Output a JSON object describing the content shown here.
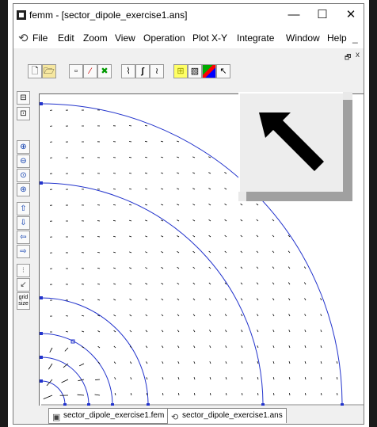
{
  "window": {
    "title": "femm - [sector_dipole_exercise1.ans]",
    "minimize_glyph": "—",
    "maximize_glyph": "☐",
    "close_glyph": "✕"
  },
  "menu": {
    "items": [
      "File",
      "Edit",
      "Zoom",
      "View",
      "Operation",
      "Plot X-Y",
      "Integrate",
      "Window",
      "Help"
    ],
    "mdi_minimize": "_",
    "mdi_restore": "🗗",
    "mdi_close": "x"
  },
  "toolbar": {
    "icons": [
      "new-file-icon",
      "open-file-icon",
      "point-mode-icon",
      "contour-mode-icon",
      "area-mode-icon",
      "plot-icon",
      "integrate-icon",
      "density-plot-icon",
      "contour-plot-icon",
      "vector-plot-icon",
      "arrow-select-icon",
      "pointer-icon"
    ]
  },
  "sidebar": {
    "icons": [
      "fit-icon",
      "zoom-natural-icon",
      "zoom-in-icon",
      "zoom-out-icon",
      "zoom-window-icon",
      "zoom-extents-icon",
      "pan-up-icon",
      "pan-down-icon",
      "pan-left-icon",
      "pan-right-icon",
      "grid-icon",
      "snap-grid-icon",
      "grid-size-icon"
    ],
    "grid_size_label": "grid\nsize"
  },
  "tabs": [
    {
      "label": "sector_dipole_exercise1.fem",
      "icon": "femm-doc-icon"
    },
    {
      "label": "sector_dipole_exercise1.ans",
      "icon": "postprocessor-icon"
    }
  ],
  "colors": {
    "boundary": "#2233cc",
    "arrow": "#000000",
    "accent": "#ffff00"
  }
}
